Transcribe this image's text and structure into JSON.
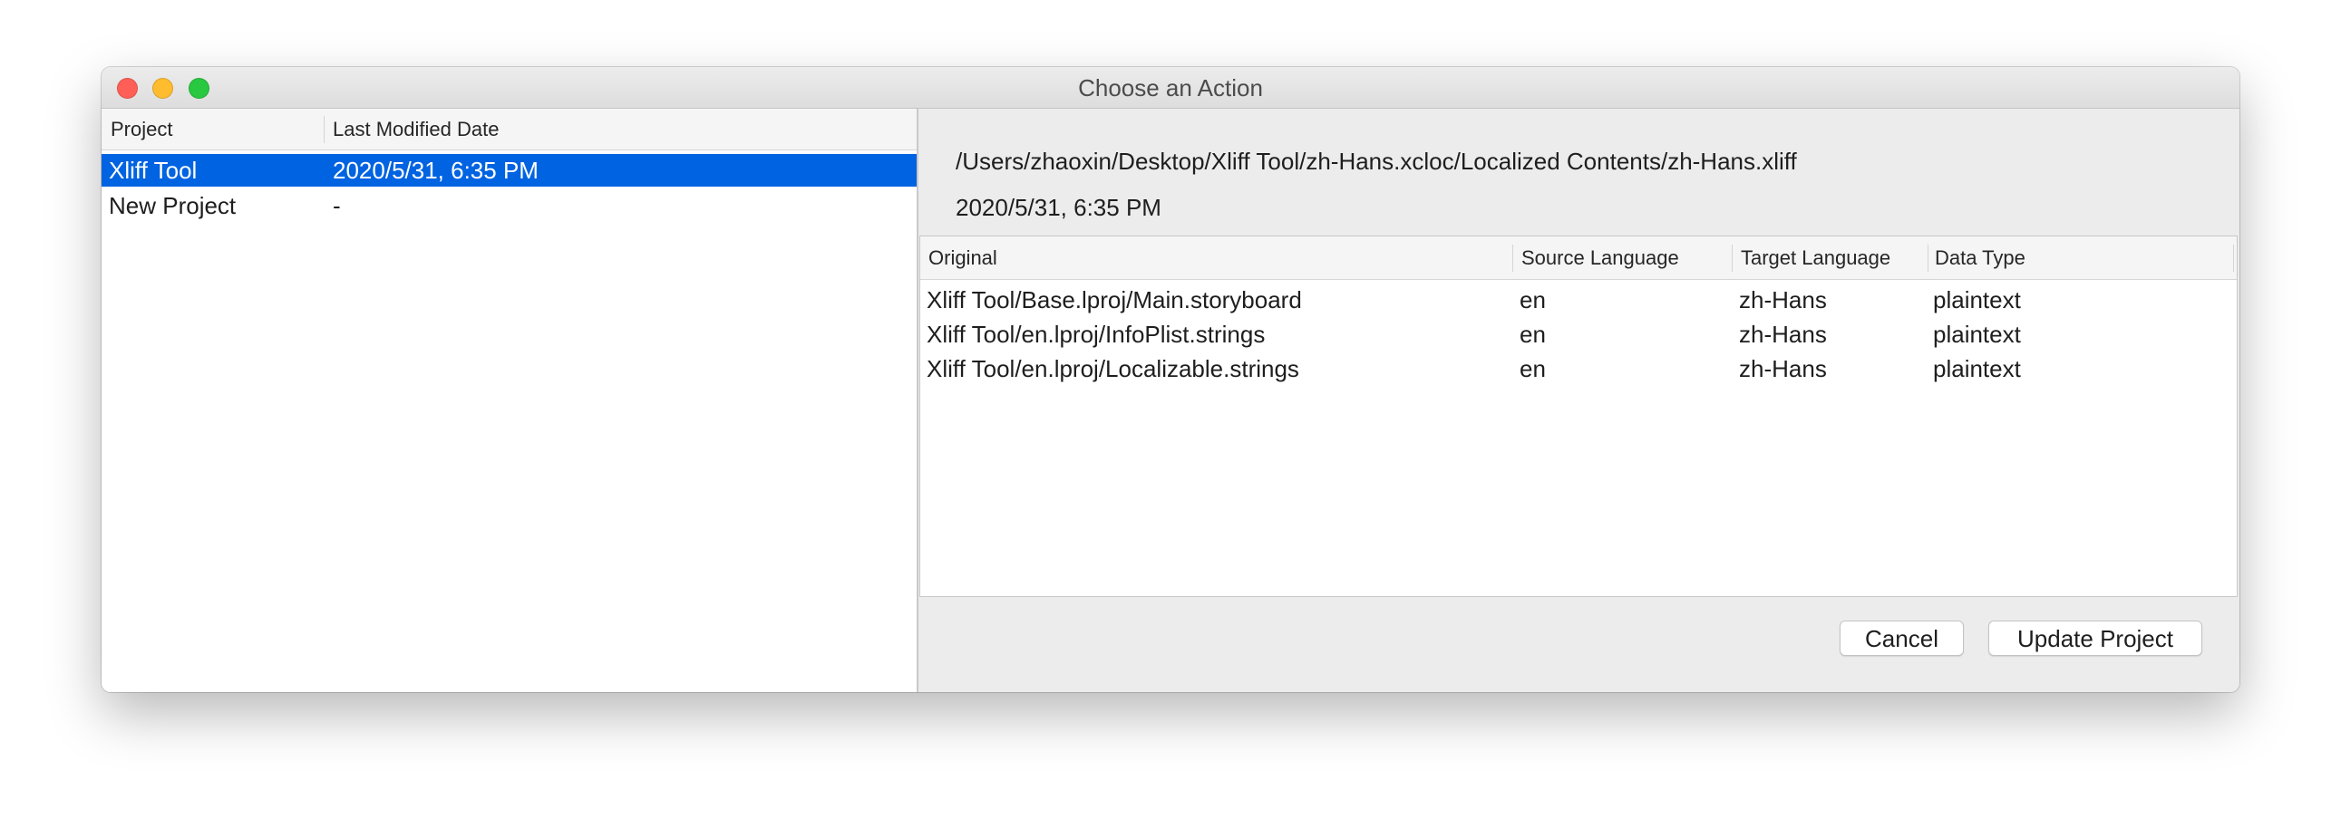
{
  "window": {
    "title": "Choose an Action",
    "traffic_lights": [
      {
        "icon": "close-icon",
        "color": "#ff5f57"
      },
      {
        "icon": "minimize-icon",
        "color": "#febc2e"
      },
      {
        "icon": "zoom-icon",
        "color": "#28c840"
      }
    ]
  },
  "projects": {
    "columns": [
      "Project",
      "Last Modified Date"
    ],
    "rows": [
      {
        "name": "Xliff Tool",
        "date": "2020/5/31, 6:35 PM",
        "selected": true
      },
      {
        "name": "New Project",
        "date": "-",
        "selected": false
      }
    ]
  },
  "details": {
    "path": "/Users/zhaoxin/Desktop/Xliff Tool/zh-Hans.xcloc/Localized Contents/zh-Hans.xliff",
    "date": "2020/5/31, 6:35 PM"
  },
  "files": {
    "columns": [
      "Original",
      "Source Language",
      "Target Language",
      "Data Type"
    ],
    "rows": [
      {
        "original": "Xliff Tool/Base.lproj/Main.storyboard",
        "source": "en",
        "target": "zh-Hans",
        "type": "plaintext"
      },
      {
        "original": "Xliff Tool/en.lproj/InfoPlist.strings",
        "source": "en",
        "target": "zh-Hans",
        "type": "plaintext"
      },
      {
        "original": "Xliff Tool/en.lproj/Localizable.strings",
        "source": "en",
        "target": "zh-Hans",
        "type": "plaintext"
      }
    ]
  },
  "buttons": {
    "cancel": "Cancel",
    "update": "Update Project"
  },
  "colors": {
    "selection": "#0063e1",
    "pane_background": "#ececec"
  }
}
